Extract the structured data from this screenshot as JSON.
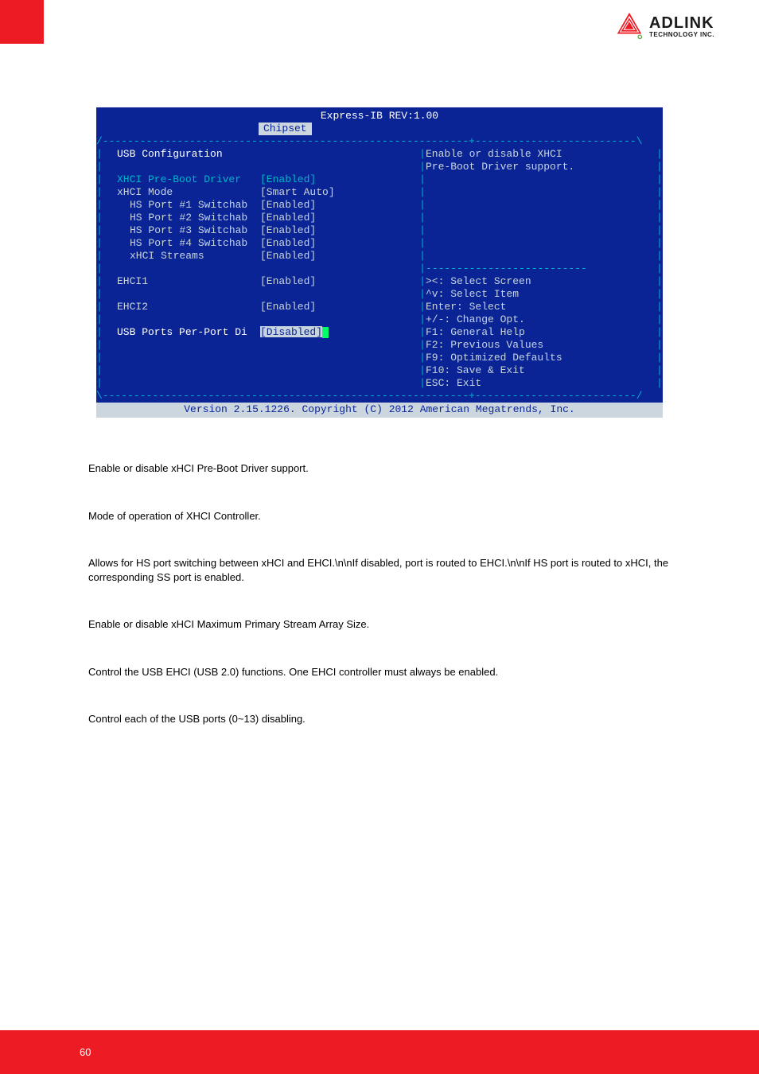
{
  "logo": {
    "brand": "ADLINK",
    "tag": "TECHNOLOGY INC."
  },
  "bios": {
    "title": "Express-IB REV:1.00",
    "tab": "Chipset",
    "heading": "USB Configuration",
    "help1": "Enable or disable XHCI",
    "help2": "Pre-Boot Driver support.",
    "rows": {
      "r0": {
        "label": "XHCI Pre-Boot Driver",
        "value": "[Enabled]"
      },
      "r1": {
        "label": "xHCI Mode",
        "value": "[Smart Auto]"
      },
      "r2": {
        "label": "HS Port #1 Switchab",
        "value": "[Enabled]"
      },
      "r3": {
        "label": "HS Port #2 Switchab",
        "value": "[Enabled]"
      },
      "r4": {
        "label": "HS Port #3 Switchab",
        "value": "[Enabled]"
      },
      "r5": {
        "label": "HS Port #4 Switchab",
        "value": "[Enabled]"
      },
      "r6": {
        "label": "xHCI Streams",
        "value": "[Enabled]"
      },
      "r7": {
        "label": "EHCI1",
        "value": "[Enabled]"
      },
      "r8": {
        "label": "EHCI2",
        "value": "[Enabled]"
      },
      "r9": {
        "label": "USB Ports Per-Port Di",
        "value": "[Disabled]"
      }
    },
    "keys": {
      "k0": "><: Select Screen",
      "k1": "^v: Select Item",
      "k2": "Enter: Select",
      "k3": "+/-: Change Opt.",
      "k4": "F1: General Help",
      "k5": "F2: Previous Values",
      "k6": "F9: Optimized Defaults",
      "k7": "F10: Save & Exit",
      "k8": "ESC: Exit"
    },
    "footer": "Version 2.15.1226. Copyright (C) 2012 American Megatrends, Inc."
  },
  "body": {
    "p0": "Enable or disable xHCI Pre-Boot Driver support.",
    "p1": "Mode of operation of XHCI Controller.",
    "p2": "Allows for HS port switching between xHCI and EHCI.\\n\\nIf disabled, port is routed to EHCI.\\n\\nIf HS port is routed to xHCI, the corresponding SS port is enabled.",
    "p3": "Enable or disable xHCI Maximum Primary Stream Array Size.",
    "p4": "Control the USB EHCI (USB 2.0) functions. One EHCI controller must always be enabled.",
    "p5": "Control each of the USB ports (0~13) disabling."
  },
  "page_number": "60"
}
